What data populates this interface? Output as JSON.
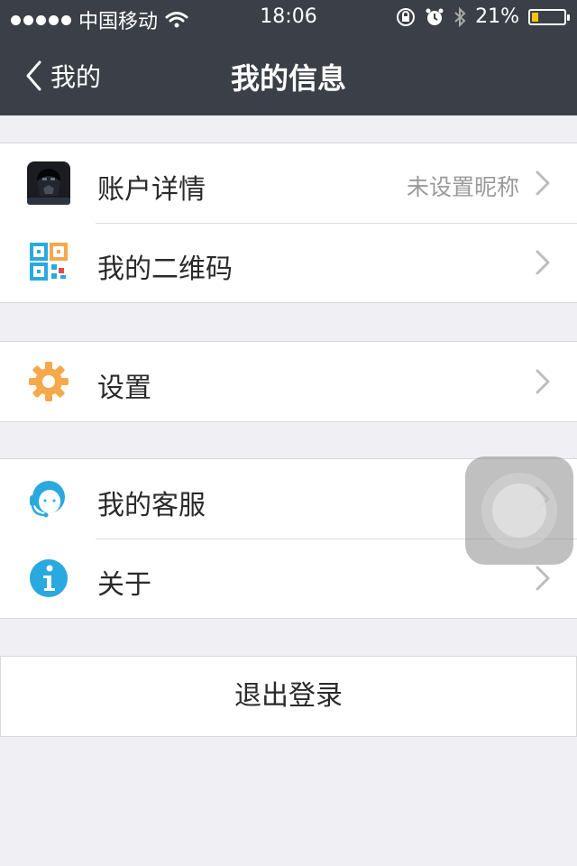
{
  "status_bar": {
    "carrier": "中国移动",
    "time": "18:06",
    "battery_text": "21%",
    "battery_level": 0.21,
    "battery_color": "#f7c400"
  },
  "nav": {
    "back_label": "我的",
    "title": "我的信息"
  },
  "groups": [
    {
      "rows": [
        {
          "label": "账户详情",
          "value": "未设置昵称",
          "icon": "avatar-icon"
        },
        {
          "label": "我的二维码",
          "value": "",
          "icon": "qr-code-icon"
        }
      ]
    },
    {
      "rows": [
        {
          "label": "设置",
          "value": "",
          "icon": "gear-icon"
        }
      ]
    },
    {
      "rows": [
        {
          "label": "我的客服",
          "value": "",
          "icon": "customer-service-icon"
        },
        {
          "label": "关于",
          "value": "",
          "icon": "info-icon"
        }
      ]
    }
  ],
  "logout_label": "退出登录",
  "colors": {
    "header_bg": "#3b3f47",
    "accent_blue": "#2aa9e0",
    "gear_orange": "#f5a94a",
    "page_bg": "#f0eff4"
  }
}
